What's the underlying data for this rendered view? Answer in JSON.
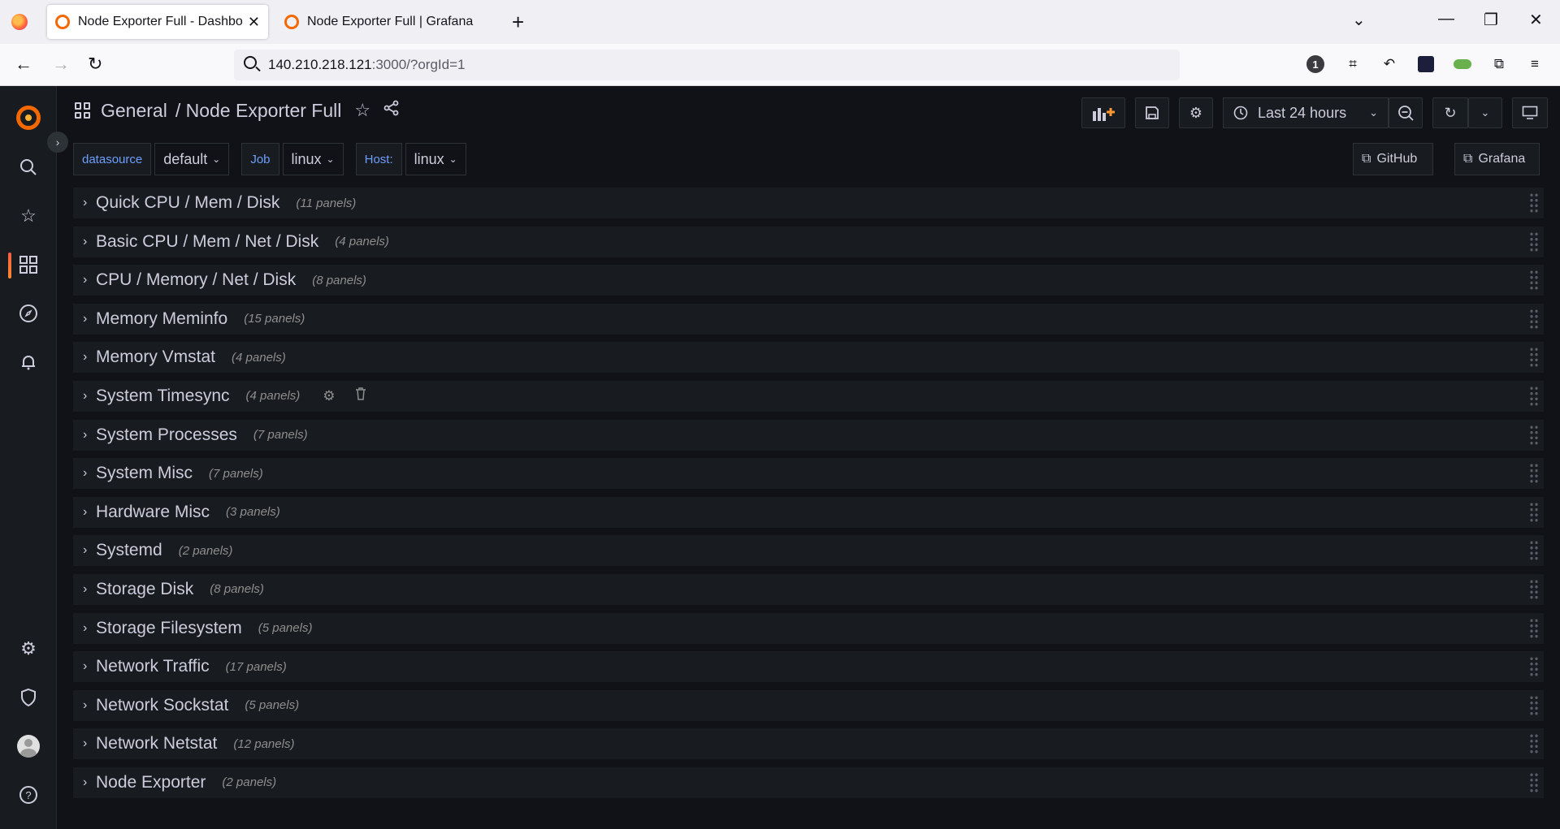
{
  "browser": {
    "tabs": [
      {
        "label": "Node Exporter Full - Dashboard",
        "active": true
      },
      {
        "label": "Node Exporter Full | Grafana Labs",
        "active": false
      }
    ],
    "url_host": "140.210.218.121",
    "url_path": ":3000/?orgId=1",
    "extension_badge": "1"
  },
  "dashboard": {
    "breadcrumb_folder": "General",
    "breadcrumb_title": "/ Node Exporter Full",
    "time_range": "Last 24 hours"
  },
  "variables": [
    {
      "label": "datasource",
      "value": "default"
    },
    {
      "label": "Job",
      "value": "linux"
    },
    {
      "label": "Host:",
      "value": "linux"
    }
  ],
  "links": [
    {
      "label": "GitHub"
    },
    {
      "label": "Grafana"
    }
  ],
  "rows": [
    {
      "title": "Quick CPU / Mem / Disk",
      "count": "(11 panels)"
    },
    {
      "title": "Basic CPU / Mem / Net / Disk",
      "count": "(4 panels)"
    },
    {
      "title": "CPU / Memory / Net / Disk",
      "count": "(8 panels)"
    },
    {
      "title": "Memory Meminfo",
      "count": "(15 panels)"
    },
    {
      "title": "Memory Vmstat",
      "count": "(4 panels)"
    },
    {
      "title": "System Timesync",
      "count": "(4 panels)"
    },
    {
      "title": "System Processes",
      "count": "(7 panels)"
    },
    {
      "title": "System Misc",
      "count": "(7 panels)"
    },
    {
      "title": "Hardware Misc",
      "count": "(3 panels)"
    },
    {
      "title": "Systemd",
      "count": "(2 panels)"
    },
    {
      "title": "Storage Disk",
      "count": "(8 panels)"
    },
    {
      "title": "Storage Filesystem",
      "count": "(5 panels)"
    },
    {
      "title": "Network Traffic",
      "count": "(17 panels)"
    },
    {
      "title": "Network Sockstat",
      "count": "(5 panels)"
    },
    {
      "title": "Network Netstat",
      "count": "(12 panels)"
    },
    {
      "title": "Node Exporter",
      "count": "(2 panels)"
    }
  ],
  "colors": {
    "accent": "#f46800",
    "link_blue": "#6e9fff",
    "background": "#111217",
    "row_bg": "#181b1f"
  }
}
